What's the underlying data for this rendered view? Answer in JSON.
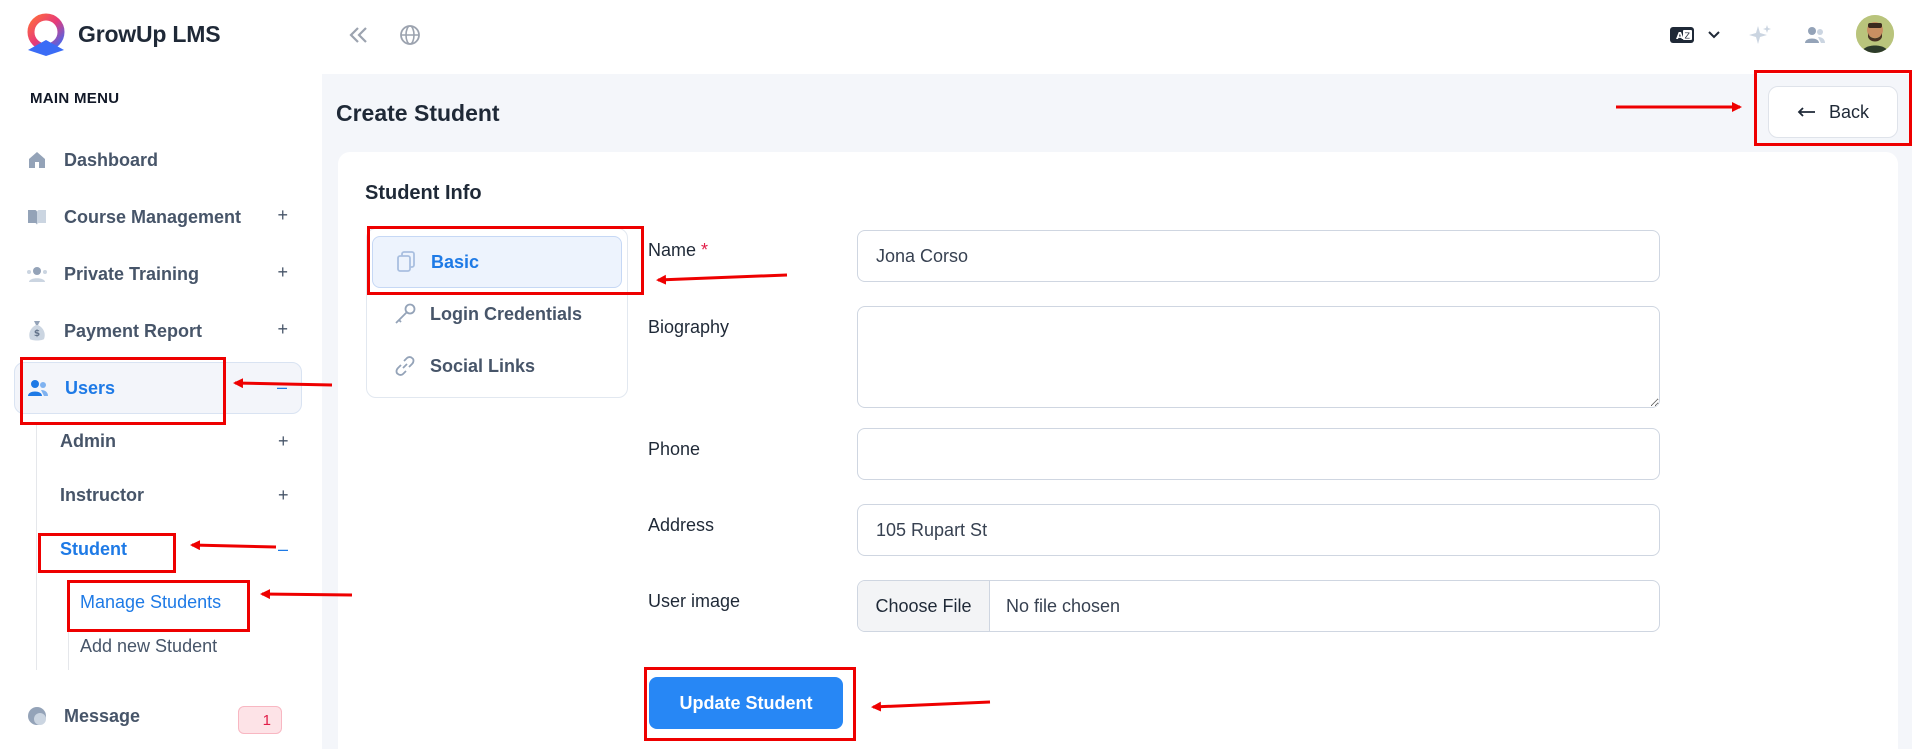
{
  "brand": {
    "name": "GrowUp LMS"
  },
  "sidebar": {
    "menu_title": "MAIN MENU",
    "items": [
      {
        "label": "Dashboard",
        "icon": "home-icon"
      },
      {
        "label": "Course Management",
        "icon": "book-icon",
        "toggle": "+"
      },
      {
        "label": "Private Training",
        "icon": "training-icon",
        "toggle": "+"
      },
      {
        "label": "Payment Report",
        "icon": "money-bag-icon",
        "toggle": "+"
      },
      {
        "label": "Users",
        "icon": "users-icon",
        "toggle": "–",
        "active": true
      }
    ],
    "users_children": [
      {
        "label": "Admin",
        "toggle": "+"
      },
      {
        "label": "Instructor",
        "toggle": "+"
      },
      {
        "label": "Student",
        "toggle": "–",
        "active": true
      }
    ],
    "student_children": [
      {
        "label": "Manage Students",
        "active": true
      },
      {
        "label": "Add new Student"
      }
    ],
    "message": {
      "label": "Message",
      "badge": "1"
    }
  },
  "header": {
    "icons": [
      "collapse-sidebar-icon",
      "globe-icon",
      "language-icon",
      "chevron-down-icon",
      "sparkle-icon",
      "users-icon",
      "avatar"
    ]
  },
  "page": {
    "title": "Create Student",
    "back_label": "Back",
    "card_title": "Student Info"
  },
  "tabs": [
    {
      "label": "Basic",
      "icon": "copy-icon",
      "active": true
    },
    {
      "label": "Login Credentials",
      "icon": "key-icon"
    },
    {
      "label": "Social Links",
      "icon": "link-icon"
    }
  ],
  "form": {
    "name": {
      "label": "Name",
      "required_mark": "*",
      "value": "Jona Corso"
    },
    "biography": {
      "label": "Biography",
      "value": ""
    },
    "phone": {
      "label": "Phone",
      "value": ""
    },
    "address": {
      "label": "Address",
      "value": "105 Rupart St"
    },
    "user_image": {
      "label": "User image",
      "button": "Choose File",
      "status": "No file chosen"
    },
    "submit_label": "Update Student"
  },
  "colors": {
    "accent": "#1e7ae6",
    "button": "#2787f5",
    "annotation": "#ee0000"
  }
}
